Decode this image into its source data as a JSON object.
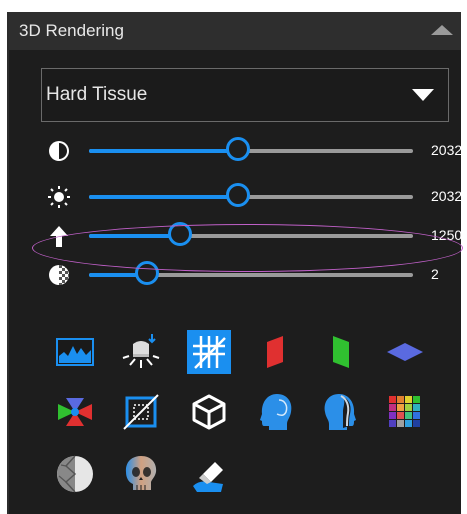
{
  "panel": {
    "title": "3D Rendering",
    "collapse_icon": "triangle-up-icon"
  },
  "preset": {
    "value": "Hard Tissue",
    "arrow_icon": "triangle-down-icon"
  },
  "sliders": [
    {
      "name": "contrast",
      "icon": "half-circle-contrast-icon",
      "value": "2032",
      "fraction": 0.46
    },
    {
      "name": "brightness",
      "icon": "sun-icon",
      "value": "2032",
      "fraction": 0.46
    },
    {
      "name": "threshold",
      "icon": "arrow-up-icon",
      "value": "1250",
      "fraction": 0.28
    },
    {
      "name": "opacity",
      "icon": "checker-circle-icon",
      "value": "2",
      "fraction": 0.18
    }
  ],
  "tools": [
    {
      "name": "histogram-icon",
      "active": false
    },
    {
      "name": "light-icon",
      "active": false
    },
    {
      "name": "clipping-hatch-icon",
      "active": true
    },
    {
      "name": "red-plane-icon",
      "active": false
    },
    {
      "name": "green-plane-icon",
      "active": false
    },
    {
      "name": "blue-plane-icon",
      "active": false
    },
    {
      "name": "axes-cube-icon",
      "active": false
    },
    {
      "name": "bounding-box-icon",
      "active": false
    },
    {
      "name": "cube-outline-icon",
      "active": false
    },
    {
      "name": "head-left-icon",
      "active": false
    },
    {
      "name": "head-right-icon",
      "active": false
    },
    {
      "name": "color-palette-icon",
      "active": false
    },
    {
      "name": "shaded-sphere-icon",
      "active": false
    },
    {
      "name": "skull-icon",
      "active": false
    },
    {
      "name": "eraser-icon",
      "active": false
    }
  ],
  "colors": {
    "accent": "#1a8ff0",
    "background": "#1d1d1d",
    "header": "#2e2e2e",
    "highlight": "#c060c8"
  }
}
